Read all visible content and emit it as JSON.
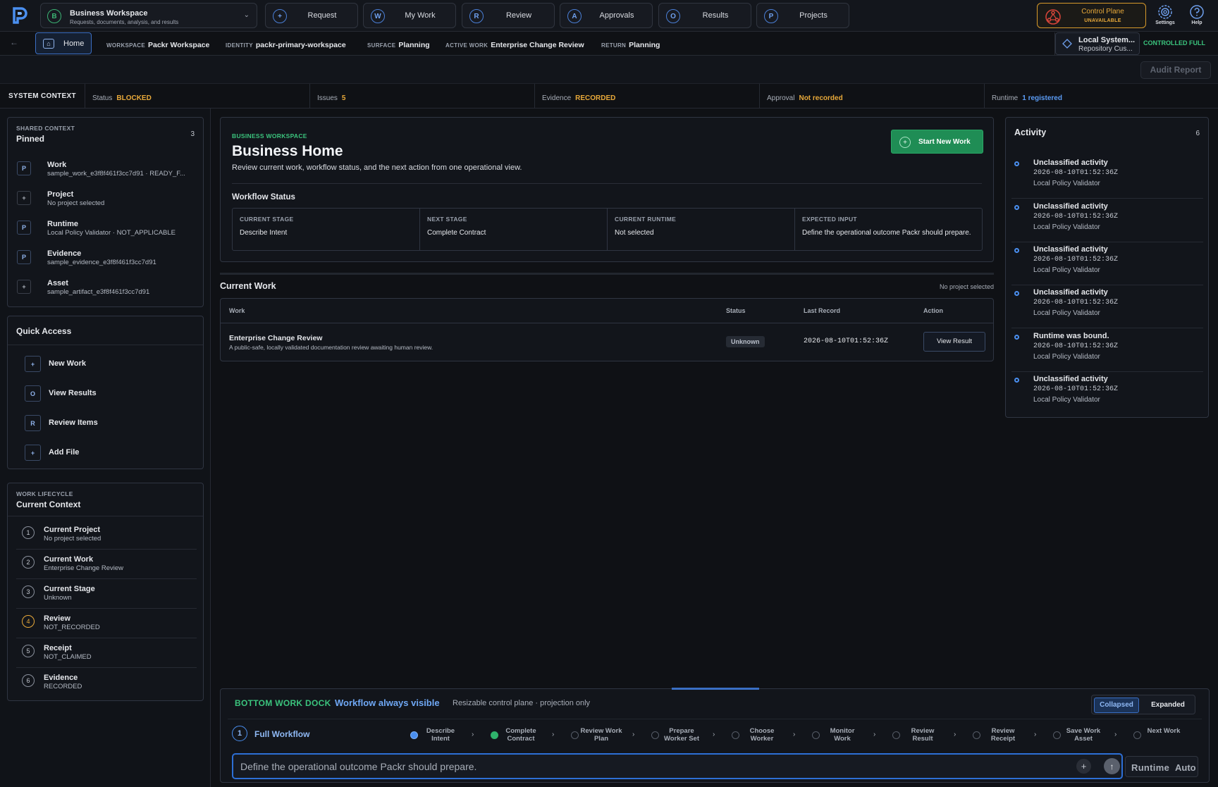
{
  "topnav": {
    "workspace": {
      "badge": "B",
      "title": "Business Workspace",
      "subtitle": "Requests, documents, analysis, and results"
    },
    "tabs": [
      {
        "icon": "+",
        "label": "Request"
      },
      {
        "icon": "W",
        "label": "My Work"
      },
      {
        "icon": "R",
        "label": "Review"
      },
      {
        "icon": "A",
        "label": "Approvals"
      },
      {
        "icon": "O",
        "label": "Results"
      },
      {
        "icon": "P",
        "label": "Projects"
      }
    ],
    "control_plane": {
      "label": "Control Plane",
      "status": "UNAVAILABLE"
    },
    "settings_label": "Settings",
    "help_label": "Help"
  },
  "context": {
    "home_label": "Home",
    "crumbs": [
      {
        "key": "WORKSPACE",
        "value": "Packr Workspace"
      },
      {
        "key": "IDENTITY",
        "value": "packr-primary-workspace"
      },
      {
        "key": "SURFACE",
        "value": "Planning"
      },
      {
        "key": "ACTIVE WORK",
        "value": "Enterprise Change Review"
      },
      {
        "key": "RETURN",
        "value": "Planning"
      }
    ],
    "local_system": {
      "title": "Local System...",
      "subtitle": "Repository Cus...",
      "mode": "CONTROLLED FULL"
    }
  },
  "audit_report_label": "Audit Report",
  "system_context": {
    "title": "SYSTEM CONTEXT",
    "items": [
      {
        "key": "Status",
        "value": "BLOCKED",
        "color": "#e8a93a"
      },
      {
        "key": "Issues",
        "value": "5",
        "color": "#e8a93a"
      },
      {
        "key": "Evidence",
        "value": "RECORDED",
        "color": "#e8a93a"
      },
      {
        "key": "Approval",
        "value": "Not recorded",
        "color": "#e8a93a"
      },
      {
        "key": "Runtime",
        "value": "1 registered",
        "color": "#5b9cf5"
      }
    ]
  },
  "shared_context": {
    "kicker": "SHARED CONTEXT",
    "title": "Pinned",
    "count": "3",
    "items": [
      {
        "icon": "P",
        "title": "Work",
        "sub": "sample_work_e3f8f461f3cc7d91 · READY_F..."
      },
      {
        "icon": "+",
        "title": "Project",
        "sub": "No project selected"
      },
      {
        "icon": "P",
        "title": "Runtime",
        "sub": "Local Policy Validator · NOT_APPLICABLE"
      },
      {
        "icon": "P",
        "title": "Evidence",
        "sub": "sample_evidence_e3f8f461f3cc7d91"
      },
      {
        "icon": "+",
        "title": "Asset",
        "sub": "sample_artifact_e3f8f461f3cc7d91"
      }
    ]
  },
  "quick_access": {
    "title": "Quick Access",
    "items": [
      {
        "icon": "+",
        "label": "New Work"
      },
      {
        "icon": "O",
        "label": "View Results"
      },
      {
        "icon": "R",
        "label": "Review Items"
      },
      {
        "icon": "+",
        "label": "Add File"
      }
    ]
  },
  "lifecycle": {
    "kicker": "WORK LIFECYCLE",
    "title": "Current Context",
    "items": [
      {
        "num": "1",
        "title": "Current Project",
        "sub": "No project selected"
      },
      {
        "num": "2",
        "title": "Current Work",
        "sub": "Enterprise Change Review"
      },
      {
        "num": "3",
        "title": "Current Stage",
        "sub": "Unknown"
      },
      {
        "num": "4",
        "title": "Review",
        "sub": "NOT_RECORDED"
      },
      {
        "num": "5",
        "title": "Receipt",
        "sub": "NOT_CLAIMED"
      },
      {
        "num": "6",
        "title": "Evidence",
        "sub": "RECORDED"
      }
    ]
  },
  "home": {
    "kicker": "BUSINESS WORKSPACE",
    "title": "Business Home",
    "subtitle": "Review current work, workflow status, and the next action from one operational view.",
    "start_label": "Start New Work",
    "workflow_status_title": "Workflow Status",
    "status": [
      {
        "key": "CURRENT STAGE",
        "value": "Describe Intent"
      },
      {
        "key": "NEXT STAGE",
        "value": "Complete Contract"
      },
      {
        "key": "CURRENT RUNTIME",
        "value": "Not selected"
      },
      {
        "key": "EXPECTED INPUT",
        "value": "Define the operational outcome Packr should prepare."
      }
    ]
  },
  "current_work": {
    "title": "Current Work",
    "project_note": "No project selected",
    "columns": [
      "Work",
      "Status",
      "Last Record",
      "Action"
    ],
    "row": {
      "title": "Enterprise Change Review",
      "desc": "A public-safe, locally validated documentation review awaiting human review.",
      "status": "Unknown",
      "last_record": "2026-08-10T01:52:36Z",
      "action": "View Result"
    }
  },
  "activity": {
    "title": "Activity",
    "count": "6",
    "items": [
      {
        "title": "Unclassified activity",
        "time": "2026-08-10T01:52:36Z",
        "source": "Local Policy Validator"
      },
      {
        "title": "Unclassified activity",
        "time": "2026-08-10T01:52:36Z",
        "source": "Local Policy Validator"
      },
      {
        "title": "Unclassified activity",
        "time": "2026-08-10T01:52:36Z",
        "source": "Local Policy Validator"
      },
      {
        "title": "Unclassified activity",
        "time": "2026-08-10T01:52:36Z",
        "source": "Local Policy Validator"
      },
      {
        "title": "Runtime was bound.",
        "time": "2026-08-10T01:52:36Z",
        "source": "Local Policy Validator"
      },
      {
        "title": "Unclassified activity",
        "time": "2026-08-10T01:52:36Z",
        "source": "Local Policy Validator"
      }
    ]
  },
  "dock": {
    "kicker": "BOTTOM WORK DOCK",
    "headline": "Workflow always visible",
    "sub": "Resizable control plane · projection only",
    "toggle": {
      "collapsed": "Collapsed",
      "expanded": "Expanded",
      "selected": "Collapsed"
    },
    "workflow": {
      "num": "1",
      "label": "Full Workflow"
    },
    "steps": [
      {
        "label": "Describe Intent",
        "state": "current"
      },
      {
        "label": "Complete Contract",
        "state": "done"
      },
      {
        "label": "Review Work Plan",
        "state": "pending"
      },
      {
        "label": "Prepare Worker Set",
        "state": "pending"
      },
      {
        "label": "Choose Worker",
        "state": "pending"
      },
      {
        "label": "Monitor Work",
        "state": "pending"
      },
      {
        "label": "Review Result",
        "state": "pending"
      },
      {
        "label": "Review Receipt",
        "state": "pending"
      },
      {
        "label": "Save Work Asset",
        "state": "pending"
      },
      {
        "label": "Next Work",
        "state": "pending"
      }
    ],
    "input_placeholder": "Define the operational outcome Packr should prepare.",
    "runtime_key": "Runtime",
    "runtime_value": "Auto"
  }
}
